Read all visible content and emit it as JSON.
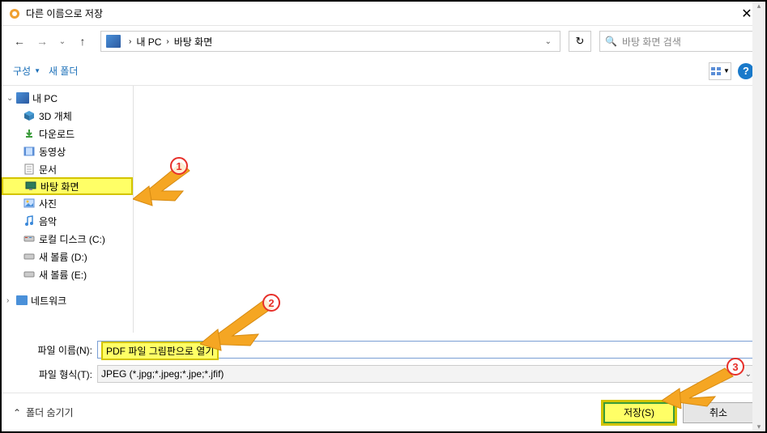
{
  "titlebar": {
    "title": "다른 이름으로 저장"
  },
  "breadcrumb": {
    "items": [
      "내 PC",
      "바탕 화면"
    ]
  },
  "search": {
    "placeholder": "바탕 화면 검색"
  },
  "toolbar": {
    "organize": "구성",
    "new_folder": "새 폴더"
  },
  "tree": {
    "root": "내 PC",
    "items": [
      {
        "label": "3D 개체",
        "icon": "cube"
      },
      {
        "label": "다운로드",
        "icon": "download"
      },
      {
        "label": "동영상",
        "icon": "video"
      },
      {
        "label": "문서",
        "icon": "document"
      },
      {
        "label": "바탕 화면",
        "icon": "desktop",
        "selected": true
      },
      {
        "label": "사진",
        "icon": "pictures"
      },
      {
        "label": "음악",
        "icon": "music"
      },
      {
        "label": "로컬 디스크 (C:)",
        "icon": "disk"
      },
      {
        "label": "새 볼륨 (D:)",
        "icon": "disk"
      },
      {
        "label": "새 볼륨 (E:)",
        "icon": "disk"
      }
    ],
    "network": "네트워크"
  },
  "fields": {
    "name_label": "파일 이름(N):",
    "name_value": "PDF 파일 그림판으로 열기",
    "type_label": "파일 형식(T):",
    "type_value": "JPEG (*.jpg;*.jpeg;*.jpe;*.jfif)"
  },
  "buttons": {
    "hide_folders": "폴더 숨기기",
    "save": "저장(S)",
    "cancel": "취소"
  },
  "annotations": {
    "one": "1",
    "two": "2",
    "three": "3"
  }
}
